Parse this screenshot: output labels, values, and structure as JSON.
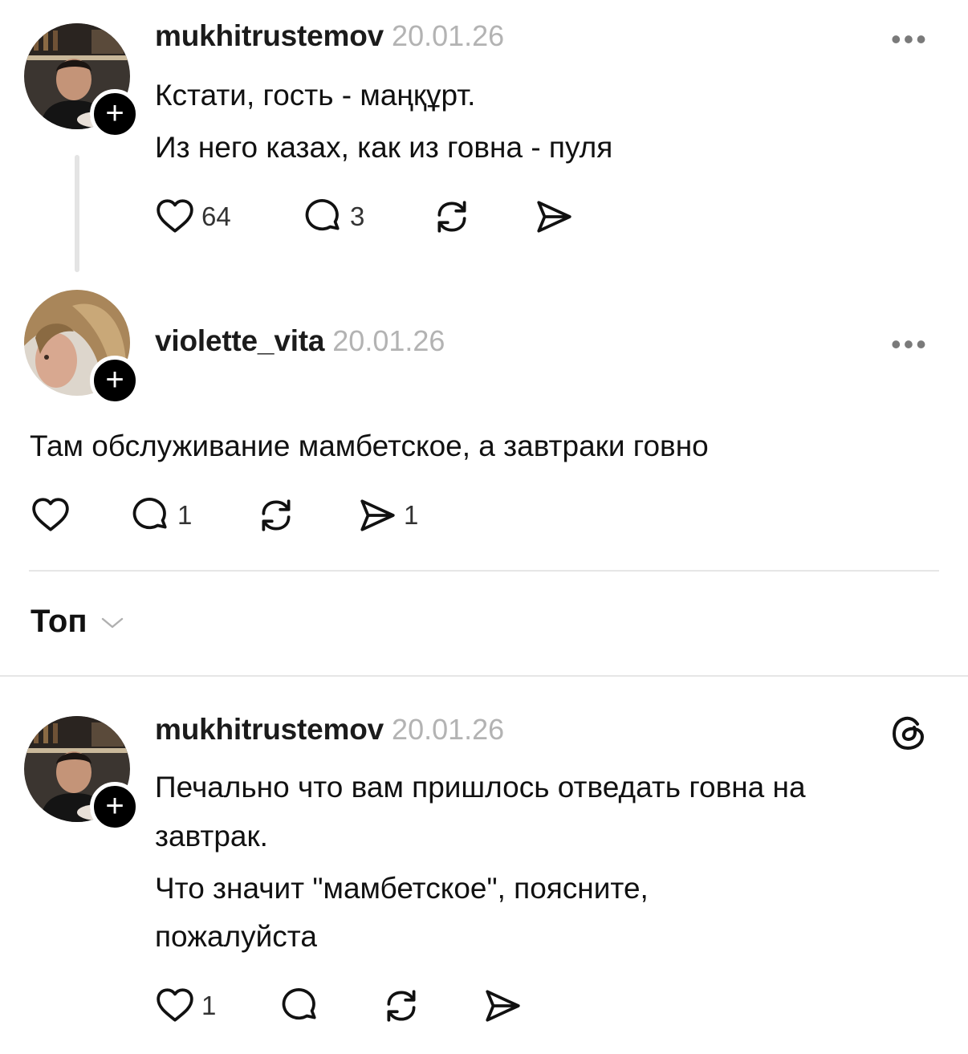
{
  "comments": [
    {
      "username": "mukhitrustemov",
      "date": "20.01.26",
      "lines": [
        "Кстати, гость - маңқұрт.",
        "Из него казах, как из говна - пуля"
      ],
      "likes": "64",
      "replies": "3",
      "reposts": "",
      "shares": ""
    },
    {
      "username": "violette_vita",
      "date": "20.01.26",
      "lines": [
        "Там обслуживание мамбетское, а завтраки говно"
      ],
      "likes": "",
      "replies": "1",
      "reposts": "",
      "shares": "1"
    },
    {
      "username": "mukhitrustemov",
      "date": "20.01.26",
      "lines": [
        "Печально что вам пришлось отведать говна на",
        "завтрак.",
        "Что значит \"мамбетское\", поясните,",
        "пожалуйста"
      ],
      "likes": "1",
      "replies": "",
      "reposts": "",
      "shares": ""
    }
  ],
  "sort": {
    "label": "Топ",
    "icon": "chevron-down-icon"
  },
  "more_glyph": "•••",
  "follow_glyph": "+",
  "icons": [
    "heart-icon",
    "comment-icon",
    "repost-icon",
    "share-icon",
    "more-icon",
    "threads-logo-icon",
    "follow-plus-icon"
  ],
  "colors": {
    "text": "#111111",
    "muted": "#b3b3b3",
    "divider": "#e6e6e6",
    "badge": "#000000"
  }
}
